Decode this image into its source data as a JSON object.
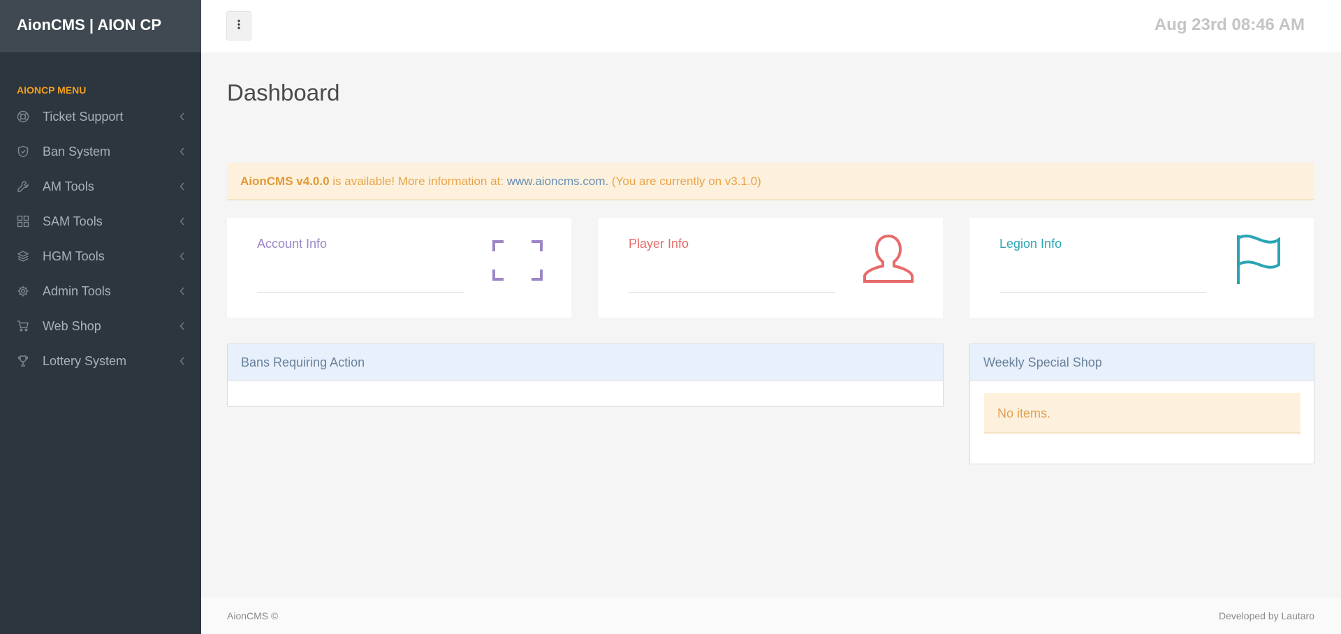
{
  "app": {
    "brand": "AionCMS | AION CP"
  },
  "topbar": {
    "clock": "Aug 23rd 08:46 AM",
    "menu_toggle_icon": "vertical-ellipsis-icon"
  },
  "sidebar": {
    "header": "AIONCP MENU",
    "items": [
      {
        "label": "Ticket Support",
        "icon": "lifebuoy-icon"
      },
      {
        "label": "Ban System",
        "icon": "shield-icon"
      },
      {
        "label": "AM Tools",
        "icon": "wrench-icon"
      },
      {
        "label": "SAM Tools",
        "icon": "grid-icon"
      },
      {
        "label": "HGM Tools",
        "icon": "layers-icon"
      },
      {
        "label": "Admin Tools",
        "icon": "gear-icon"
      },
      {
        "label": "Web Shop",
        "icon": "cart-icon"
      },
      {
        "label": "Lottery System",
        "icon": "trophy-icon"
      }
    ]
  },
  "page": {
    "title": "Dashboard"
  },
  "alert": {
    "version": "AionCMS v4.0.0",
    "text_before_link": " is available! More information at: ",
    "link": "www.aioncms.com.",
    "text_after_link": " (You are currently on v3.1.0)"
  },
  "cards": [
    {
      "title": "Account Info",
      "color": "#9c86c7",
      "icon": "fullscreen-icon"
    },
    {
      "title": "Player Info",
      "color": "#e86a6a",
      "icon": "user-icon"
    },
    {
      "title": "Legion Info",
      "color": "#2aa5b4",
      "icon": "flag-icon"
    }
  ],
  "panels": {
    "bans": {
      "title": "Bans Requiring Action"
    },
    "shop": {
      "title": "Weekly Special Shop",
      "empty_text": "No items."
    }
  },
  "footer": {
    "left": "AionCMS ©",
    "right": "Developed by Lautaro"
  },
  "colors": {
    "sidebar_bg": "#2d353e",
    "brand_bg": "#404951",
    "menu_header": "#f0a020"
  }
}
